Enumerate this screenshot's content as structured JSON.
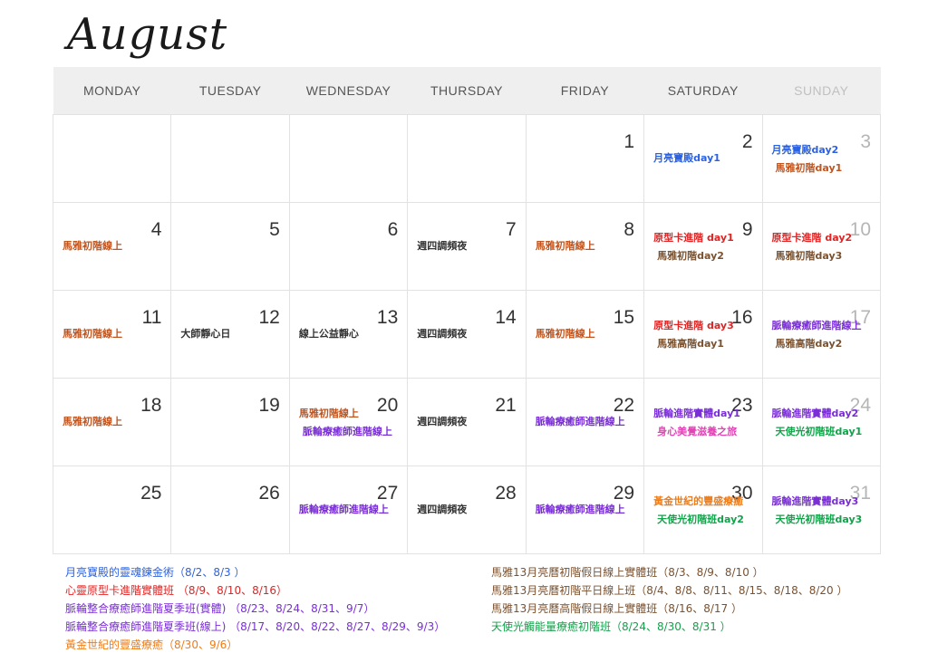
{
  "title": "August",
  "weekdays": [
    "MONDAY",
    "TUESDAY",
    "WEDNESDAY",
    "THURSDAY",
    "FRIDAY",
    "SATURDAY",
    "SUNDAY"
  ],
  "colors": {
    "blue": "#2b62e3",
    "orange": "#c2541d",
    "brown": "#7a5230",
    "red": "#e02424",
    "purple": "#7a2ed6",
    "dark": "#333333",
    "green": "#12a24a",
    "pink": "#e045b5",
    "gold": "#f07c16"
  },
  "weeks": [
    [
      {
        "day": "",
        "events": []
      },
      {
        "day": "",
        "events": []
      },
      {
        "day": "",
        "events": []
      },
      {
        "day": "",
        "events": []
      },
      {
        "day": "1",
        "events": []
      },
      {
        "day": "2",
        "events": [
          {
            "text": "月亮寶殿day1",
            "color": "blue"
          }
        ]
      },
      {
        "day": "3",
        "events": [
          {
            "text": "月亮寶殿day2",
            "color": "blue"
          },
          {
            "text": "馬雅初階day1",
            "color": "orange"
          }
        ]
      }
    ],
    [
      {
        "day": "4",
        "events": [
          {
            "text": "馬雅初階線上",
            "color": "orange"
          }
        ]
      },
      {
        "day": "5",
        "events": []
      },
      {
        "day": "6",
        "events": []
      },
      {
        "day": "7",
        "events": [
          {
            "text": "週四調頻夜",
            "color": "dark"
          }
        ]
      },
      {
        "day": "8",
        "events": [
          {
            "text": "馬雅初階線上",
            "color": "orange"
          }
        ]
      },
      {
        "day": "9",
        "events": [
          {
            "text": "原型卡進階 day1",
            "color": "red"
          },
          {
            "text": "馬雅初階day2",
            "color": "brown"
          }
        ]
      },
      {
        "day": "10",
        "events": [
          {
            "text": "原型卡進階 day2",
            "color": "red"
          },
          {
            "text": "馬雅初階day3",
            "color": "brown"
          }
        ]
      }
    ],
    [
      {
        "day": "11",
        "events": [
          {
            "text": "馬雅初階線上",
            "color": "orange"
          }
        ]
      },
      {
        "day": "12",
        "events": [
          {
            "text": "大師靜心日",
            "color": "dark"
          }
        ]
      },
      {
        "day": "13",
        "events": [
          {
            "text": "線上公益靜心",
            "color": "dark"
          }
        ]
      },
      {
        "day": "14",
        "events": [
          {
            "text": "週四調頻夜",
            "color": "dark"
          }
        ]
      },
      {
        "day": "15",
        "events": [
          {
            "text": "馬雅初階線上",
            "color": "orange"
          }
        ]
      },
      {
        "day": "16",
        "events": [
          {
            "text": "原型卡進階 day3",
            "color": "red"
          },
          {
            "text": "馬雅高階day1",
            "color": "brown"
          }
        ]
      },
      {
        "day": "17",
        "events": [
          {
            "text": "脈輪療癒師進階線上",
            "color": "purple"
          },
          {
            "text": "馬雅高階day2",
            "color": "brown"
          }
        ]
      }
    ],
    [
      {
        "day": "18",
        "events": [
          {
            "text": "馬雅初階線上",
            "color": "orange"
          }
        ]
      },
      {
        "day": "19",
        "events": []
      },
      {
        "day": "20",
        "events": [
          {
            "text": "馬雅初階線上",
            "color": "orange"
          },
          {
            "text": "脈輪療癒師進階線上",
            "color": "purple"
          }
        ]
      },
      {
        "day": "21",
        "events": [
          {
            "text": "週四調頻夜",
            "color": "dark"
          }
        ]
      },
      {
        "day": "22",
        "events": [
          {
            "text": "脈輪療癒師進階線上",
            "color": "purple"
          }
        ]
      },
      {
        "day": "23",
        "events": [
          {
            "text": "脈輪進階實體day1",
            "color": "purple"
          },
          {
            "text": "身心美覺滋養之旅",
            "color": "pink"
          }
        ]
      },
      {
        "day": "24",
        "events": [
          {
            "text": "脈輪進階實體day2",
            "color": "purple"
          },
          {
            "text": "天使光初階班day1",
            "color": "green"
          }
        ]
      }
    ],
    [
      {
        "day": "25",
        "events": []
      },
      {
        "day": "26",
        "events": []
      },
      {
        "day": "27",
        "events": [
          {
            "text": "脈輪療癒師進階線上",
            "color": "purple"
          }
        ]
      },
      {
        "day": "28",
        "events": [
          {
            "text": "週四調頻夜",
            "color": "dark"
          }
        ]
      },
      {
        "day": "29",
        "events": [
          {
            "text": "脈輪療癒師進階線上",
            "color": "purple"
          }
        ]
      },
      {
        "day": "30",
        "events": [
          {
            "text": "黃金世紀的豐盛療癒",
            "color": "gold"
          },
          {
            "text": "天使光初階班day2",
            "color": "green"
          }
        ]
      },
      {
        "day": "31",
        "events": [
          {
            "text": "脈輪進階實體day3",
            "color": "purple"
          },
          {
            "text": "天使光初階班day3",
            "color": "green"
          }
        ]
      }
    ]
  ],
  "legend_left": [
    {
      "text": "月亮寶殿的靈魂鍊金術（8/2、8/3 ）",
      "color": "blue"
    },
    {
      "text": "心靈原型卡進階實體班 （8/9、8/10、8/16）",
      "color": "red"
    },
    {
      "text": "脈輪整合療癒師進階夏季班(實體) （8/23、8/24、8/31、9/7）",
      "color": "purple"
    },
    {
      "text": "脈輪整合療癒師進階夏季班(線上) （8/17、8/20、8/22、8/27、8/29、9/3）",
      "color": "purple"
    },
    {
      "text": "黃金世紀的豐盛療癒（8/30、9/6）",
      "color": "gold"
    }
  ],
  "legend_right": [
    {
      "text": "馬雅13月亮曆初階假日線上實體班（8/3、8/9、8/10 ）",
      "color": "brown"
    },
    {
      "text": "馬雅13月亮曆初階平日線上班（8/4、8/8、8/11、8/15、8/18、8/20 ）",
      "color": "brown"
    },
    {
      "text": "馬雅13月亮曆高階假日線上實體班（8/16、8/17 ）",
      "color": "brown"
    },
    {
      "text": "天使光觸能量療癒初階班（8/24、8/30、8/31 ）",
      "color": "green"
    }
  ]
}
